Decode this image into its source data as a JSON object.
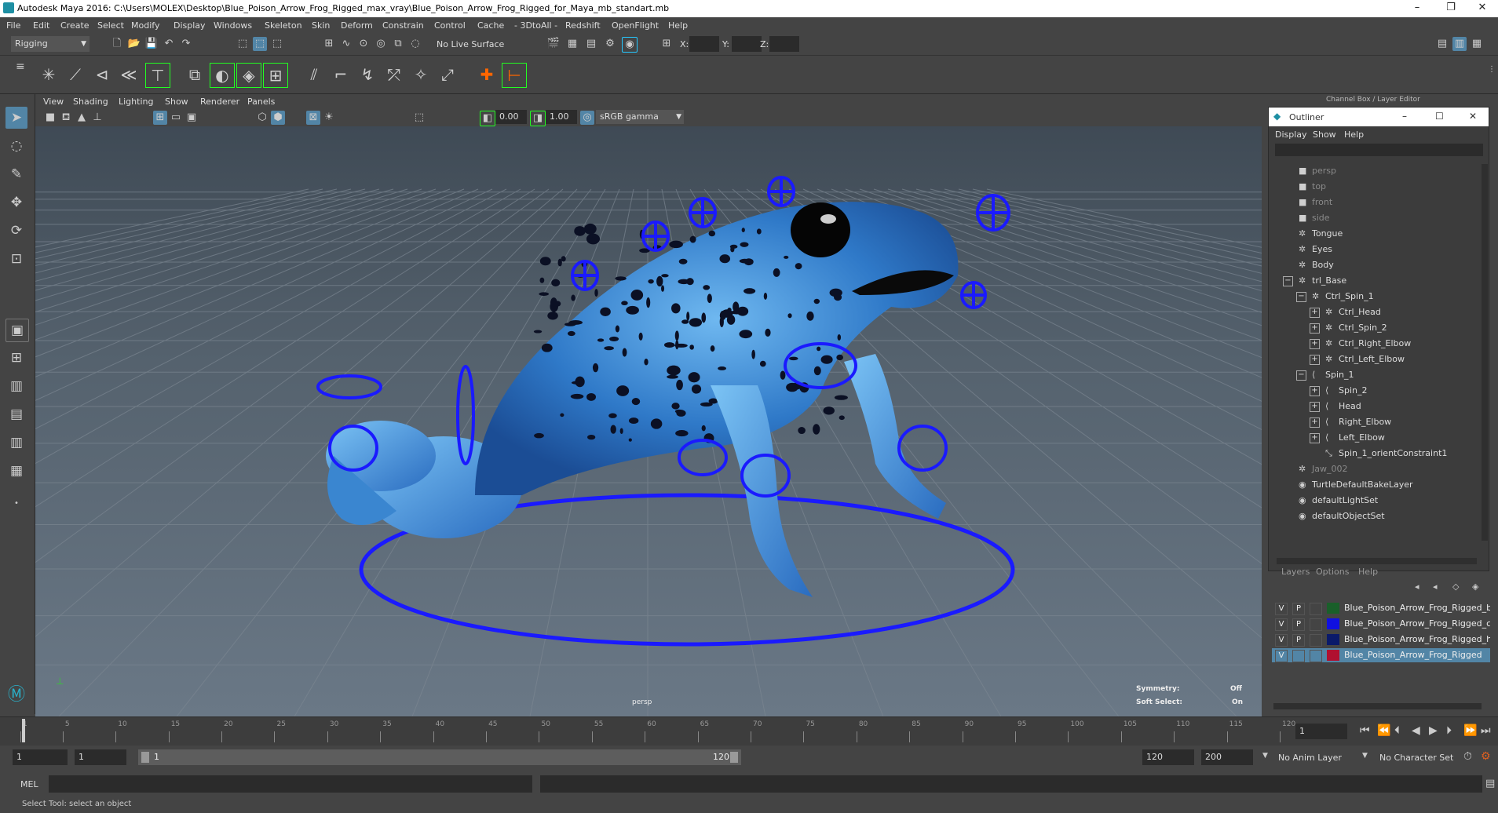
{
  "window": {
    "title": "Autodesk Maya 2016: C:\\Users\\MOLEX\\Desktop\\Blue_Poison_Arrow_Frog_Rigged_max_vray\\Blue_Poison_Arrow_Frog_Rigged_for_Maya_mb_standart.mb"
  },
  "menubar": [
    "File",
    "Edit",
    "Create",
    "Select",
    "Modify",
    "Display",
    "Windows",
    "Skeleton",
    "Skin",
    "Deform",
    "Constrain",
    "Control",
    "Cache",
    "- 3DtoAll -",
    "Redshift",
    "OpenFlight",
    "Help"
  ],
  "statusline": {
    "menuset": "Rigging",
    "live_surface": "No Live Surface",
    "x_label": "X:",
    "y_label": "Y:",
    "z_label": "Z:"
  },
  "viewport": {
    "menu": [
      "View",
      "Shading",
      "Lighting",
      "Show",
      "Renderer",
      "Panels"
    ],
    "exposure": "0.00",
    "gamma": "1.00",
    "colorspace": "sRGB gamma",
    "camera_label": "persp",
    "hud": {
      "symmetry_label": "Symmetry:",
      "symmetry_value": "Off",
      "soft_select_label": "Soft Select:",
      "soft_select_value": "On"
    }
  },
  "channelbox_header": "Channel Box / Layer Editor",
  "outliner": {
    "title": "Outliner",
    "menu": [
      "Display",
      "Show",
      "Help"
    ],
    "items": [
      {
        "label": "persp",
        "indent": 0,
        "dim": true,
        "icon": "camera"
      },
      {
        "label": "top",
        "indent": 0,
        "dim": true,
        "icon": "camera"
      },
      {
        "label": "front",
        "indent": 0,
        "dim": true,
        "icon": "camera"
      },
      {
        "label": "side",
        "indent": 0,
        "dim": true,
        "icon": "camera"
      },
      {
        "label": "Tongue",
        "indent": 0,
        "dim": false,
        "icon": "transform"
      },
      {
        "label": "Eyes",
        "indent": 0,
        "dim": false,
        "icon": "transform"
      },
      {
        "label": "Body",
        "indent": 0,
        "dim": false,
        "icon": "transform"
      },
      {
        "label": "trl_Base",
        "indent": 0,
        "dim": false,
        "icon": "transform",
        "expand": "−"
      },
      {
        "label": "Ctrl_Spin_1",
        "indent": 1,
        "dim": false,
        "icon": "transform",
        "expand": "−"
      },
      {
        "label": "Ctrl_Head",
        "indent": 2,
        "dim": false,
        "icon": "transform",
        "expand": "+"
      },
      {
        "label": "Ctrl_Spin_2",
        "indent": 2,
        "dim": false,
        "icon": "transform",
        "expand": "+"
      },
      {
        "label": "Ctrl_Right_Elbow",
        "indent": 2,
        "dim": false,
        "icon": "transform",
        "expand": "+"
      },
      {
        "label": "Ctrl_Left_Elbow",
        "indent": 2,
        "dim": false,
        "icon": "transform",
        "expand": "+"
      },
      {
        "label": "Spin_1",
        "indent": 1,
        "dim": false,
        "icon": "joint",
        "expand": "−"
      },
      {
        "label": "Spin_2",
        "indent": 2,
        "dim": false,
        "icon": "joint",
        "expand": "+"
      },
      {
        "label": "Head",
        "indent": 2,
        "dim": false,
        "icon": "joint",
        "expand": "+"
      },
      {
        "label": "Right_Elbow",
        "indent": 2,
        "dim": false,
        "icon": "joint",
        "expand": "+"
      },
      {
        "label": "Left_Elbow",
        "indent": 2,
        "dim": false,
        "icon": "joint",
        "expand": "+"
      },
      {
        "label": "Spin_1_orientConstraint1",
        "indent": 2,
        "dim": false,
        "icon": "constraint"
      },
      {
        "label": "Jaw_002",
        "indent": 0,
        "dim": true,
        "icon": "transform"
      },
      {
        "label": "TurtleDefaultBakeLayer",
        "indent": 0,
        "dim": false,
        "icon": "set"
      },
      {
        "label": "defaultLightSet",
        "indent": 0,
        "dim": false,
        "icon": "set"
      },
      {
        "label": "defaultObjectSet",
        "indent": 0,
        "dim": false,
        "icon": "set"
      }
    ]
  },
  "layer_editor": {
    "tabs": [
      "Layers",
      "Options",
      "Help"
    ],
    "layers": [
      {
        "v": "V",
        "p": "P",
        "color": "#1a5f2a",
        "name": "Blue_Poison_Arrow_Frog_Rigged_b",
        "selected": false
      },
      {
        "v": "V",
        "p": "P",
        "color": "#1010e0",
        "name": "Blue_Poison_Arrow_Frog_Rigged_c",
        "selected": false
      },
      {
        "v": "V",
        "p": "P",
        "color": "#0a1a6a",
        "name": "Blue_Poison_Arrow_Frog_Rigged_h",
        "selected": false
      },
      {
        "v": "V",
        "p": "",
        "color": "#b01030",
        "name": "Blue_Poison_Arrow_Frog_Rigged",
        "selected": true
      }
    ]
  },
  "timeline": {
    "ticks": [
      "1",
      "5",
      "10",
      "15",
      "20",
      "25",
      "30",
      "35",
      "40",
      "45",
      "50",
      "55",
      "60",
      "65",
      "70",
      "75",
      "80",
      "85",
      "90",
      "95",
      "100",
      "105",
      "110",
      "115",
      "120"
    ],
    "current_frame": "1"
  },
  "range": {
    "start": "1",
    "anim_start": "1",
    "range_start": "1",
    "range_end": "120",
    "end": "120",
    "anim_end": "200",
    "anim_layer": "No Anim Layer",
    "char_set": "No Character Set"
  },
  "cmdline": {
    "label": "MEL"
  },
  "helpline": {
    "text": "Select Tool: select an object"
  },
  "colors": {
    "accent": "#5285a6",
    "control_blue": "#1a1aff"
  }
}
